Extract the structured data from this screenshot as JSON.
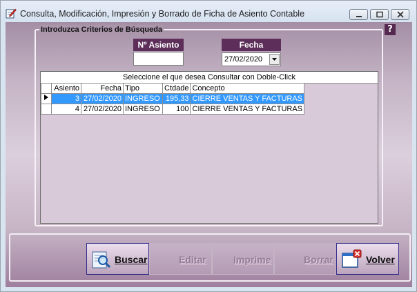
{
  "window": {
    "title": "Consulta, Modificación, Impresión y Borrado de Ficha de Asiento Contable",
    "icon": "edit-document-icon",
    "controls": [
      "minimize-icon",
      "maximize-icon",
      "close-icon"
    ]
  },
  "help": {
    "label": "?"
  },
  "criteria": {
    "legend": "Introduzca Criterios de Búsqueda",
    "asiento_label": "Nº Asiento",
    "asiento_value": "",
    "fecha_label": "Fecha",
    "fecha_value": "27/02/2020"
  },
  "grid": {
    "caption": "Seleccione el que desea Consultar con Doble-Click",
    "columns": [
      "Asiento",
      "Fecha",
      "Tipo",
      "Ctdade",
      "Concepto"
    ],
    "rows": [
      {
        "asiento": "3",
        "fecha": "27/02/2020",
        "tipo": "INGRESO",
        "ctdade": "195,33",
        "concepto": "CIERRE VENTAS Y FACTURAS",
        "selected": true
      },
      {
        "asiento": "4",
        "fecha": "27/02/2020",
        "tipo": "INGRESO",
        "ctdade": "100",
        "concepto": "CIERRE VENTAS Y FACTURAS",
        "selected": false
      }
    ]
  },
  "buttons": {
    "buscar": {
      "label": "Buscar",
      "enabled": true,
      "icon": "search-document-icon"
    },
    "editar": {
      "label": "Editar",
      "enabled": false
    },
    "imprime": {
      "label": "Imprime",
      "enabled": false
    },
    "borrar": {
      "label": "Borrar",
      "enabled": false
    },
    "volver": {
      "label": "Volver",
      "enabled": true,
      "icon": "close-window-icon"
    }
  },
  "colors": {
    "header_purple": "#5c2e59",
    "selection_blue": "#3399ff",
    "button_border": "#2f2a8a"
  }
}
